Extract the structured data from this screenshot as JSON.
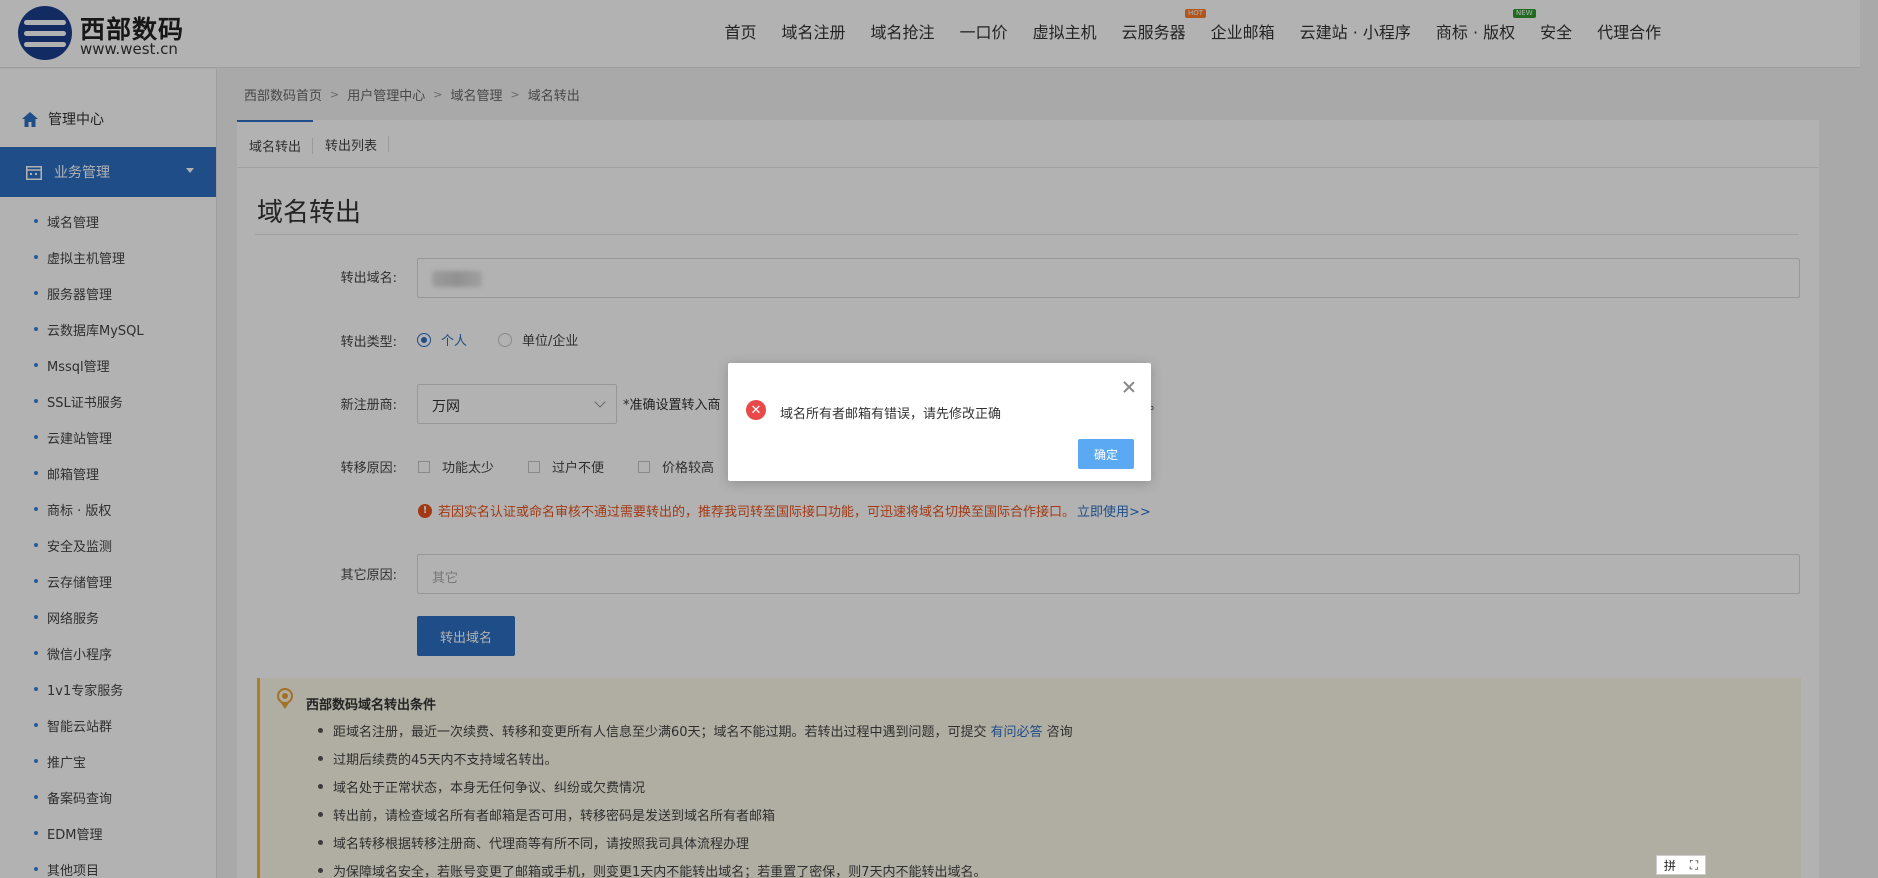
{
  "header": {
    "logo_name": "西部数码",
    "logo_url": "www.west.cn",
    "nav": [
      {
        "label": "首页"
      },
      {
        "label": "域名注册"
      },
      {
        "label": "域名抢注"
      },
      {
        "label": "一口价"
      },
      {
        "label": "虚拟主机"
      },
      {
        "label": "云服务器",
        "badge": "HOT"
      },
      {
        "label": "企业邮箱"
      },
      {
        "label": "云建站 · 小程序"
      },
      {
        "label": "商标 · 版权",
        "badge": "NEW"
      },
      {
        "label": "安全"
      },
      {
        "label": "代理合作"
      }
    ]
  },
  "sidebar": {
    "home_label": "管理中心",
    "active_label": "业务管理",
    "items": [
      "域名管理",
      "虚拟主机管理",
      "服务器管理",
      "云数据库MySQL",
      "Mssql管理",
      "SSL证书服务",
      "云建站管理",
      "邮箱管理",
      "商标 · 版权",
      "安全及监测",
      "云存储管理",
      "网络服务",
      "微信小程序",
      "1v1专家服务",
      "智能云站群",
      "推广宝",
      "备案码查询",
      "EDM管理",
      "其他项目"
    ]
  },
  "breadcrumb": [
    "西部数码首页",
    "用户管理中心",
    "域名管理",
    "域名转出"
  ],
  "tabs": [
    "域名转出",
    "转出列表"
  ],
  "page_title": "域名转出",
  "form": {
    "domain_label": "转出域名:",
    "type_label": "转出类型:",
    "type_options": [
      "个人",
      "单位/企业"
    ],
    "registrar_label": "新注册商:",
    "registrar_value": "万网",
    "registrar_hint": "*准确设置转入商",
    "registrar_hint_tail": "。",
    "reason_label": "转移原因:",
    "reasons": [
      "功能太少",
      "过户不便",
      "价格较高"
    ],
    "warning": "若因实名认证或命名审核不通过需要转出的，推荐我司转至国际接口功能，可迅速将域名切换至国际合作接口。",
    "warning_link": "立即使用>>",
    "other_label": "其它原因:",
    "other_placeholder": "其它",
    "submit_label": "转出域名"
  },
  "notice": {
    "title": "西部数码域名转出条件",
    "items": [
      {
        "text": "距域名注册，最近一次续费、转移和变更所有人信息至少满60天；域名不能过期。若转出过程中遇到问题，可提交",
        "link": "有问必答",
        "tail": "咨询"
      },
      {
        "text": "过期后续费的45天内不支持域名转出。"
      },
      {
        "text": "域名处于正常状态，本身无任何争议、纠纷或欠费情况"
      },
      {
        "text": "转出前，请检查域名所有者邮箱是否可用，转移密码是发送到域名所有者邮箱"
      },
      {
        "text": "域名转移根据转移注册商、代理商等有所不同，请按照我司具体流程办理"
      },
      {
        "text": "为保障域名安全，若账号变更了邮箱或手机，则变更1天内不能转出域名；若重置了密保，则7天内不能转出域名。"
      }
    ]
  },
  "modal": {
    "message": "域名所有者邮箱有错误，请先修改正确",
    "ok_label": "确定"
  },
  "ime": {
    "label": "拼"
  }
}
